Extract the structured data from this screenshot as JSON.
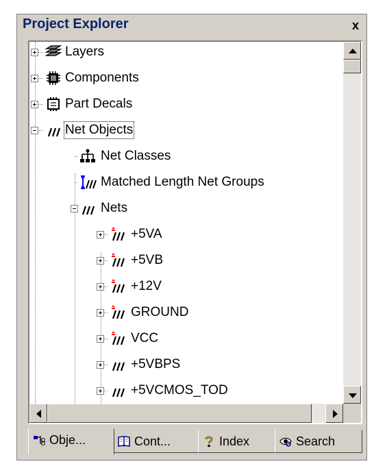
{
  "panel": {
    "title": "Project Explorer",
    "close_label": "x"
  },
  "tree": {
    "nodes": [
      {
        "label": "Layers",
        "icon": "layers-icon",
        "expander": "plus"
      },
      {
        "label": "Components",
        "icon": "components-icon",
        "expander": "plus"
      },
      {
        "label": "Part Decals",
        "icon": "part-decals-icon",
        "expander": "plus"
      },
      {
        "label": "Net Objects",
        "icon": "net-objects-icon",
        "expander": "minus"
      },
      {
        "label": "Net Classes",
        "icon": "net-classes-icon",
        "expander": "none"
      },
      {
        "label": "Matched Length Net Groups",
        "icon": "matched-length-icon",
        "expander": "none"
      },
      {
        "label": "Nets",
        "icon": "nets-icon",
        "expander": "minus"
      },
      {
        "label": "+5VA",
        "icon": "net-flagged-icon",
        "expander": "plus"
      },
      {
        "label": "+5VB",
        "icon": "net-flagged-icon",
        "expander": "plus"
      },
      {
        "label": "+12V",
        "icon": "net-flagged-icon",
        "expander": "plus"
      },
      {
        "label": "GROUND",
        "icon": "net-flagged-icon",
        "expander": "plus"
      },
      {
        "label": "VCC",
        "icon": "net-flagged-icon",
        "expander": "plus"
      },
      {
        "label": "+5VBPS",
        "icon": "net-icon",
        "expander": "plus"
      },
      {
        "label": "+5VCMOS_TOD",
        "icon": "net-icon",
        "expander": "plus"
      }
    ]
  },
  "tabs": [
    {
      "label": "Obje...",
      "icon": "objects-tab-icon",
      "active": true
    },
    {
      "label": "Cont...",
      "icon": "book-icon",
      "active": false
    },
    {
      "label": "Index",
      "icon": "question-icon",
      "active": false
    },
    {
      "label": "Search",
      "icon": "search-eye-icon",
      "active": false
    }
  ],
  "colors": {
    "title_text": "#0a246a",
    "face": "#d4d0c8",
    "net_flag": "#ff0000",
    "accent_blue": "#0000ff"
  }
}
